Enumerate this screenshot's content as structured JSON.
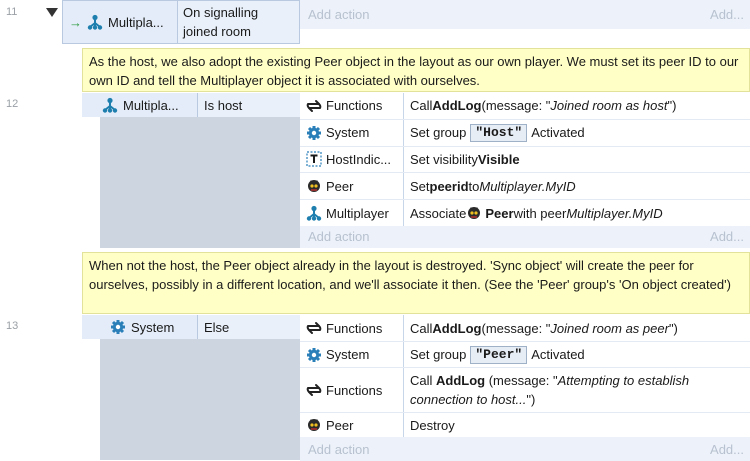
{
  "events": [
    {
      "line": "11",
      "condition": {
        "object": "Multipla...",
        "text": "On signalling joined room"
      },
      "add_action": "Add action",
      "add_short": "Add..."
    },
    {
      "comment": "As the host, we also adopt the existing Peer object in the layout as our own player. We must set its peer ID to our own ID and tell the Multiplayer object it is associated with ourselves."
    },
    {
      "line": "12",
      "condition": {
        "object": "Multipla...",
        "text": "Is host"
      },
      "actions": [
        {
          "icon": "functions-icon",
          "object": "Functions",
          "pre": "Call ",
          "bold": "AddLog",
          "mid": " (message: \"",
          "italic": "Joined room as host",
          "post": "\")"
        },
        {
          "icon": "system-gear-icon",
          "object": "System",
          "pre": "Set group ",
          "group": "\"Host\"",
          "post": " Activated"
        },
        {
          "icon": "text-object-icon",
          "object": "HostIndic...",
          "pre": "Set visibility ",
          "bold": "Visible"
        },
        {
          "icon": "peer-sprite-icon",
          "object": "Peer",
          "pre": "Set ",
          "bold": "peerid",
          "mid": " to ",
          "italic": "Multiplayer.MyID"
        },
        {
          "icon": "multiplayer-icon",
          "object": "Multiplayer",
          "pre": "Associate ",
          "bold": "Peer",
          "mid": " with peer ",
          "italic": "Multiplayer.MyID"
        }
      ],
      "add_action": "Add action",
      "add_short": "Add..."
    },
    {
      "comment": "When not the host, the Peer object already in the layout is destroyed. 'Sync object' will create the peer for ourselves, possibly in a different location, and we'll associate it then. (See the 'Peer' group's 'On object created')"
    },
    {
      "line": "13",
      "condition": {
        "object": "System",
        "text": "Else"
      },
      "actions": [
        {
          "icon": "functions-icon",
          "object": "Functions",
          "pre": "Call ",
          "bold": "AddLog",
          "mid": " (message: \"",
          "italic": "Joined room as peer",
          "post": "\")"
        },
        {
          "icon": "system-gear-icon",
          "object": "System",
          "pre": "Set group ",
          "group": "\"Peer\"",
          "post": " Activated"
        },
        {
          "icon": "functions-icon",
          "object": "Functions",
          "pre": "Call ",
          "bold": "AddLog",
          "mid": " (message: \"",
          "italic": "Attempting to establish connection to host...",
          "post": "\")"
        },
        {
          "icon": "peer-sprite-icon",
          "object": "Peer",
          "pre": "Destroy"
        }
      ],
      "add_action": "Add action",
      "add_short": "Add..."
    }
  ],
  "colors": {
    "comment_bg": "#ffffc6",
    "condition_bg": "#e3ecf8",
    "add_action_text": "#b7c1cf",
    "accent": "#1e7fae"
  }
}
